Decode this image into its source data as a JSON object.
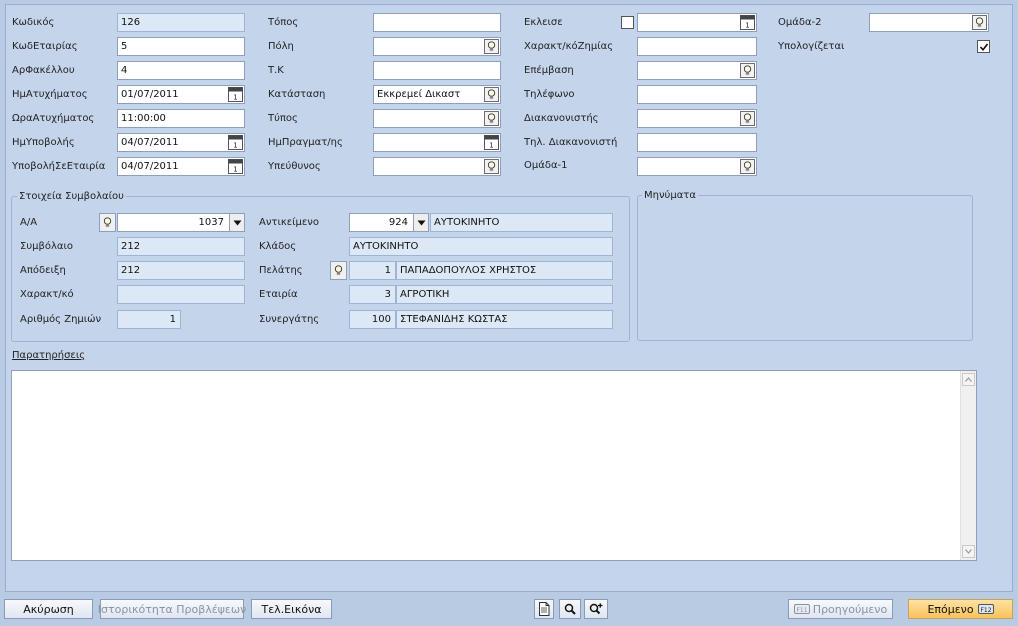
{
  "form": {
    "col1": [
      {
        "label": "Κωδικός",
        "value": "126"
      },
      {
        "label": "ΚωδΕταιρίας",
        "value": "5"
      },
      {
        "label": "ΑρΦακέλλου",
        "value": "4"
      },
      {
        "label": "ΗμΑτυχήματος",
        "value": "01/07/2011"
      },
      {
        "label": "ΩραΑτυχήματος",
        "value": "11:00:00"
      },
      {
        "label": "ΗμΥποβολής",
        "value": "04/07/2011"
      },
      {
        "label": "ΥποβολήΣεΕταιρία",
        "value": "04/07/2011"
      }
    ],
    "col2": [
      {
        "label": "Τόπος",
        "value": ""
      },
      {
        "label": "Πόλη",
        "value": ""
      },
      {
        "label": "Τ.Κ",
        "value": ""
      },
      {
        "label": "Κατάσταση",
        "value": "Εκκρεμεί Δικαστ"
      },
      {
        "label": "Τύπος",
        "value": ""
      },
      {
        "label": "ΗμΠραγματ/ης",
        "value": ""
      },
      {
        "label": "Υπεύθυνος",
        "value": ""
      }
    ],
    "col3": [
      {
        "label": "Εκλεισε",
        "value": ""
      },
      {
        "label": "Χαρακτ/κόΖημίας",
        "value": ""
      },
      {
        "label": "Επέμβαση",
        "value": ""
      },
      {
        "label": "Τηλέφωνο",
        "value": ""
      },
      {
        "label": "Διακανονιστής",
        "value": ""
      },
      {
        "label": "Τηλ. Διακανονιστή",
        "value": ""
      },
      {
        "label": "Ομάδα-1",
        "value": ""
      }
    ],
    "col4": [
      {
        "label": "Ομάδα-2",
        "value": ""
      },
      {
        "label": "Υπολογίζεται",
        "value": ""
      }
    ]
  },
  "contract": {
    "title": "Στοιχεία Συμβολαίου",
    "aa_label": "Α/Α",
    "aa_value": "1037",
    "contract_label": "Συμβόλαιο",
    "contract_value": "212",
    "receipt_label": "Απόδειξη",
    "receipt_value": "212",
    "charact_label": "Χαρακτ/κό",
    "charact_value": "",
    "damages_label": "Αριθμός Ζημιών",
    "damages_value": "1",
    "object_label": "Αντικείμενο",
    "object_code": "924",
    "object_name": "ΑΥΤΟΚΙΝΗΤΟ",
    "branch_label": "Κλάδος",
    "branch_value": "ΑΥΤΟΚΙΝΗΤΟ",
    "client_label": "Πελάτης",
    "client_code": "1",
    "client_name": "ΠΑΠΑΔΟΠΟΥΛΟΣ ΧΡΗΣΤΟΣ",
    "company_label": "Εταιρία",
    "company_code": "3",
    "company_name": "ΑΓΡΟΤΙΚΗ",
    "partner_label": "Συνεργάτης",
    "partner_code": "100",
    "partner_name": "ΣΤΕΦΑΝΙΔΗΣ ΚΩΣΤΑΣ"
  },
  "messages": {
    "title": "Μηνύματα"
  },
  "notes": {
    "label": "Παρατηρήσεις",
    "value": ""
  },
  "footer": {
    "cancel": "Ακύρωση",
    "history": "Ιστορικότητα Προβλέψεων",
    "final_image": "Τελ.Εικόνα",
    "prev": "Προηγούμενο",
    "next": "Επόμενο"
  },
  "colors": {
    "background": "#b9cbe3",
    "panel": "#c4d5eb",
    "readonly": "#dce8f6",
    "primary": "#f8c25a"
  }
}
